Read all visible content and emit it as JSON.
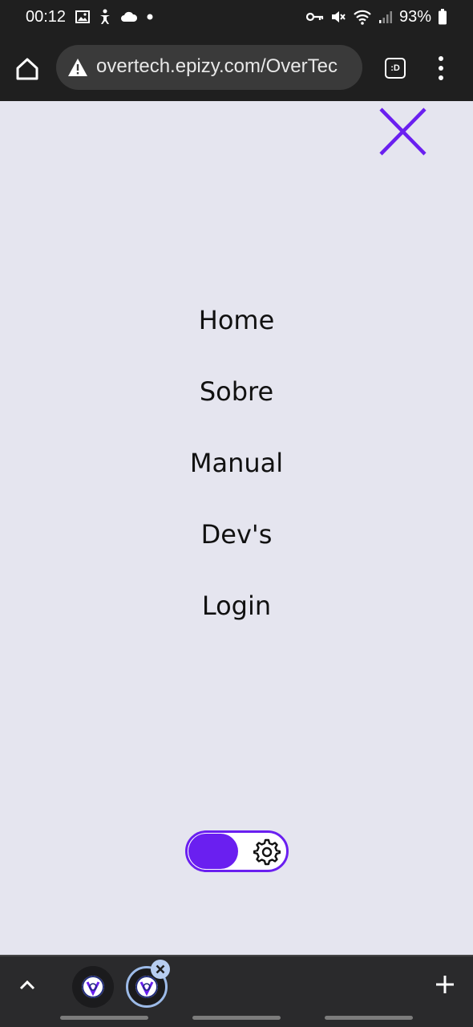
{
  "status_bar": {
    "time": "00:12",
    "battery": "93%",
    "left_icons": [
      "image-icon",
      "accessibility-icon",
      "cloud-icon",
      "dot-icon"
    ],
    "right_icons": [
      "key-icon",
      "mute-icon",
      "wifi-icon",
      "signal-icon",
      "battery-icon"
    ]
  },
  "browser": {
    "url": "overtech.epizy.com/OverTec",
    "tabs_label": ":D",
    "icons": [
      "home-icon",
      "warning-icon",
      "more-vert-icon"
    ]
  },
  "menu": {
    "items": [
      {
        "label": "Home"
      },
      {
        "label": "Sobre"
      },
      {
        "label": "Manual"
      },
      {
        "label": "Dev's"
      },
      {
        "label": "Login"
      }
    ],
    "close_icon": "close-icon",
    "accent_color": "#6a1ff0"
  },
  "theme_toggle": {
    "on": true,
    "icon": "gear-icon"
  },
  "tab_strip": {
    "icons": [
      "chevron-up-icon",
      "favicon-icon",
      "close-icon",
      "plus-icon"
    ]
  },
  "colors": {
    "page_background": "#e5e5ef",
    "chrome_background": "#1f1f1f",
    "accent": "#6a1ff0"
  }
}
